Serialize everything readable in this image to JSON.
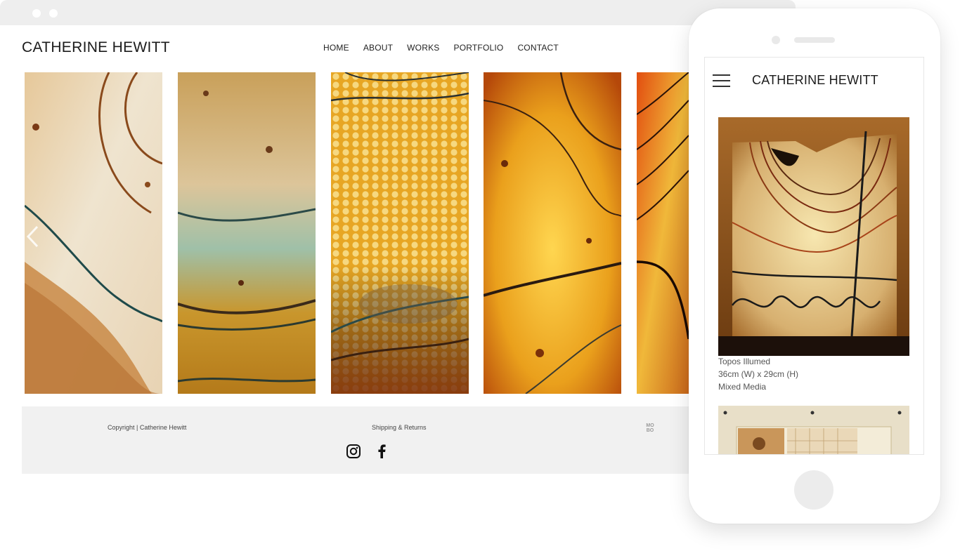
{
  "site": {
    "name": "CATHERINE HEWITT",
    "nav": [
      "HOME",
      "ABOUT",
      "WORKS",
      "PORTFOLIO",
      "CONTACT"
    ]
  },
  "gallery": {
    "panels": [
      {
        "name": "artwork-panel-1",
        "palette": [
          "#ecdcc0",
          "#b9762a",
          "#6f3a14"
        ]
      },
      {
        "name": "artwork-panel-2",
        "palette": [
          "#d7b46f",
          "#a86a1a",
          "#5a3a1a"
        ]
      },
      {
        "name": "artwork-panel-3",
        "palette": [
          "#e9a21a",
          "#c36a0a",
          "#3a2410"
        ]
      },
      {
        "name": "artwork-panel-4",
        "palette": [
          "#f1b21a",
          "#cf6a0a",
          "#4a200a"
        ]
      },
      {
        "name": "artwork-panel-5",
        "palette": [
          "#e8a020",
          "#c04010",
          "#2a1208"
        ]
      }
    ]
  },
  "footer": {
    "copyright": "Copyright | Catherine Hewitt",
    "shipping": "Shipping & Returns",
    "badge": "MO BO",
    "social": [
      "instagram-icon",
      "facebook-icon"
    ]
  },
  "mobile": {
    "title": "CATHERINE HEWITT",
    "artwork": {
      "title": "Topos Illumed",
      "dimensions": "36cm (W) x 29cm (H)",
      "medium": "Mixed Media"
    }
  },
  "colors": {
    "browser_bar": "#eeeeee",
    "footer_bg": "#f1f1f1",
    "text": "#222222"
  }
}
